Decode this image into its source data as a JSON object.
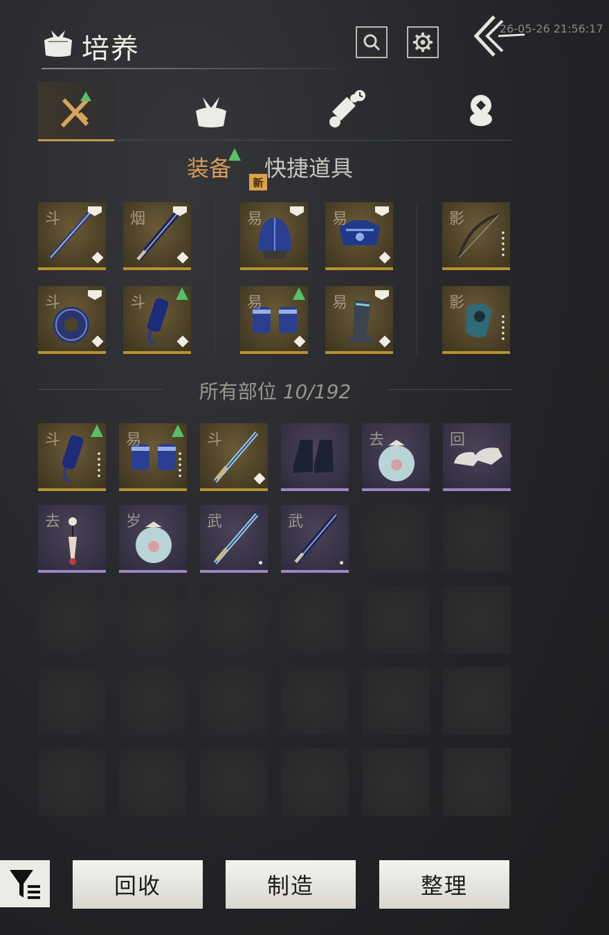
{
  "header": {
    "title": "培养",
    "timestamp": "26-05-26 21:56:17",
    "icons": [
      "bundle-icon",
      "search-icon",
      "gear-icon",
      "back-arrow-icon"
    ]
  },
  "category_tabs": [
    {
      "name": "weapons-tab",
      "icon": "crossed-swords-icon",
      "active": true,
      "upgrade_indicator": true
    },
    {
      "name": "bundle-tab",
      "icon": "bundle-icon",
      "badge": "新"
    },
    {
      "name": "scroll-tab",
      "icon": "scroll-icon",
      "indicator": "clock-icon"
    },
    {
      "name": "currency-tab",
      "icon": "coin-stack-icon"
    }
  ],
  "sub_tabs": {
    "equipment": "装备",
    "quick_items": "快捷道具"
  },
  "equipped_slots": [
    {
      "tag": "斗",
      "rarity": "gold",
      "icon": "spear-icon",
      "marker": "level",
      "corner": "diamond"
    },
    {
      "tag": "烟",
      "rarity": "gold",
      "icon": "blade-icon",
      "marker": "level",
      "corner": "diamond"
    },
    {
      "tag": "易",
      "rarity": "gold",
      "icon": "helmet-icon",
      "marker": "level"
    },
    {
      "tag": "易",
      "rarity": "gold",
      "icon": "chest-armor-icon",
      "marker": "level",
      "corner": "diamond"
    },
    {
      "tag": "影",
      "rarity": "gold",
      "icon": "bow-icon",
      "corner": "dots"
    },
    {
      "tag": "斗",
      "rarity": "gold",
      "icon": "ring-icon",
      "marker": "level",
      "corner": "diamond"
    },
    {
      "tag": "斗",
      "rarity": "gold",
      "icon": "talisman-icon",
      "marker": "upgrade",
      "corner": "diamond"
    },
    {
      "tag": "易",
      "rarity": "gold",
      "icon": "bracers-icon",
      "marker": "upgrade",
      "corner": "diamond"
    },
    {
      "tag": "易",
      "rarity": "gold",
      "icon": "greaves-icon",
      "marker": "level",
      "corner": "diamond"
    },
    {
      "tag": "影",
      "rarity": "gold",
      "icon": "pendant-icon",
      "corner": "dots"
    }
  ],
  "inventory": {
    "label": "所有部位",
    "count": "10/192",
    "capacity_shown": 30,
    "items": [
      {
        "tag": "斗",
        "rarity": "gold",
        "icon": "talisman-icon",
        "marker": "upgrade",
        "corner": "dots"
      },
      {
        "tag": "易",
        "rarity": "gold",
        "icon": "bracers-icon",
        "marker": "upgrade",
        "corner": "dots"
      },
      {
        "tag": "斗",
        "rarity": "gold",
        "icon": "sword-icon",
        "corner": "diamond"
      },
      {
        "tag": "",
        "rarity": "purple",
        "icon": "boots-icon"
      },
      {
        "tag": "去",
        "rarity": "purple",
        "icon": "pouch-icon"
      },
      {
        "tag": "回",
        "rarity": "purple",
        "icon": "shoes-icon"
      },
      {
        "tag": "去",
        "rarity": "purple",
        "icon": "tassel-icon"
      },
      {
        "tag": "岁",
        "rarity": "purple",
        "icon": "pouch-icon"
      },
      {
        "tag": "武",
        "rarity": "purple",
        "icon": "sword-icon",
        "corner": "dot"
      },
      {
        "tag": "武",
        "rarity": "purple",
        "icon": "blade-icon",
        "corner": "dot"
      }
    ]
  },
  "bottom_bar": {
    "filter_icon": "filter-icon",
    "recycle": "回收",
    "craft": "制造",
    "organize": "整理"
  },
  "colors": {
    "accent_gold": "#d79a55",
    "gold_rarity": "#b7922e",
    "purple_rarity": "#9d86c4",
    "upgrade_green": "#56c06a",
    "new_badge": "#d9a24a"
  }
}
